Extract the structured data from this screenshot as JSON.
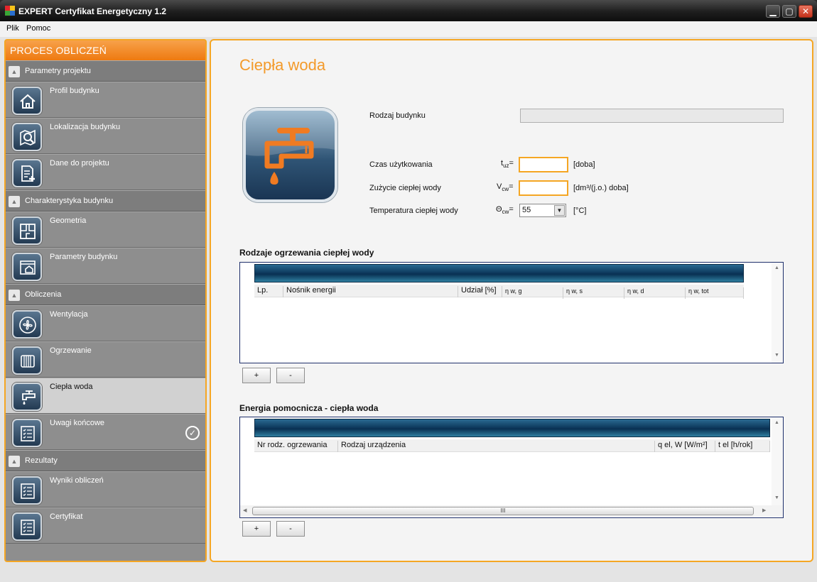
{
  "window": {
    "title": "EXPERT Certyfikat Energetyczny 1.2",
    "minimize": "▁",
    "maximize": "▢",
    "close": "✕"
  },
  "menu": [
    "Plik",
    "Pomoc"
  ],
  "sidebar": {
    "header": "PROCES OBLICZEŃ",
    "sections": [
      {
        "label": "Parametry projektu",
        "items": [
          {
            "label": "Profil budynku",
            "icon": "house-icon"
          },
          {
            "label": "Lokalizacja budynku",
            "icon": "map-search-icon"
          },
          {
            "label": "Dane do projektu",
            "icon": "document-add-icon"
          }
        ]
      },
      {
        "label": "Charakterystyka budynku",
        "items": [
          {
            "label": "Geometria",
            "icon": "floorplan-icon"
          },
          {
            "label": "Parametry budynku",
            "icon": "building-settings-icon"
          }
        ]
      },
      {
        "label": "Obliczenia",
        "items": [
          {
            "label": "Wentylacja",
            "icon": "fan-icon"
          },
          {
            "label": "Ogrzewanie",
            "icon": "radiator-icon"
          },
          {
            "label": "Ciepła woda",
            "icon": "faucet-icon"
          },
          {
            "label": "Uwagi końcowe",
            "icon": "checklist-icon"
          }
        ]
      },
      {
        "label": "Rezultaty",
        "items": [
          {
            "label": "Wyniki obliczeń",
            "icon": "checklist-icon"
          },
          {
            "label": "Certyfikat",
            "icon": "checklist-icon"
          }
        ]
      }
    ],
    "active": "Ciepła woda",
    "completed_mark": "✓"
  },
  "main": {
    "title": "Ciepła woda",
    "hero_icon": "faucet-icon",
    "fields": {
      "rodzaj_budynku": {
        "label": "Rodzaj budynku",
        "value": ""
      },
      "czas": {
        "label": "Czas użytkowania",
        "symbol": "t",
        "sub": "uz",
        "eq": "=",
        "value": "",
        "unit": "[doba]"
      },
      "zuzycie": {
        "label": "Zużycie ciepłej wody",
        "symbol": "V",
        "sub": "cw",
        "eq": "=",
        "value": "",
        "unit": "[dm³/(j.o.) doba]"
      },
      "temperatura": {
        "label": "Temperatura ciepłej wody",
        "symbol": "Θ",
        "sub": "cw",
        "eq": "=",
        "value": "55",
        "unit": "[°C]"
      }
    },
    "table1": {
      "title": "Rodzaje ogrzewania ciepłej wody",
      "columns": [
        "Lp.",
        "Nośnik energii",
        "Udział [%]",
        "η w, g",
        "η w, s",
        "η w, d",
        "η w, tot"
      ],
      "rows": [],
      "add": "+",
      "remove": "-"
    },
    "table2": {
      "title": "Energia pomocnicza - ciepła woda",
      "columns": [
        "Nr rodz. ogrzewania",
        "Rodzaj urządzenia",
        "q el, W [W/m²]",
        "t el [h/rok]"
      ],
      "rows": [],
      "add": "+",
      "remove": "-"
    }
  },
  "colors": {
    "accent": "#f5a623",
    "title": "#f39a2a",
    "grid_bar": "#0f3c60"
  }
}
